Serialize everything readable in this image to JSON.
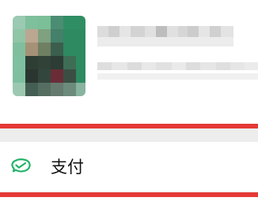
{
  "pay": {
    "label": "支付",
    "icon": "wechat-pay-icon"
  },
  "colors": {
    "accent_red": "#e53935",
    "pay_icon_green": "#24b26a",
    "background": "#ededed"
  }
}
